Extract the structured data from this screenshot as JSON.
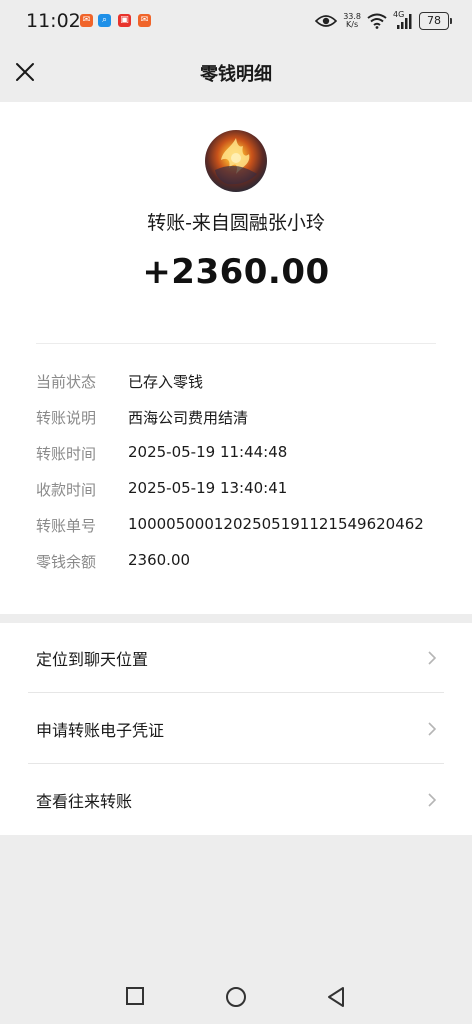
{
  "status_bar": {
    "time": "11:02",
    "net_speed_value": "33.8",
    "net_speed_unit": "K/s",
    "network_type": "4G",
    "battery_level": "78",
    "notification_icons": [
      "app-notification-icon",
      "app-notification-icon",
      "app-notification-icon",
      "app-notification-icon"
    ]
  },
  "header": {
    "title": "零钱明细",
    "close_icon": "close-icon"
  },
  "transfer": {
    "sender_line": "转账-来自圆融张小玲",
    "amount": "+2360.00"
  },
  "details": [
    {
      "label": "当前状态",
      "value": "已存入零钱"
    },
    {
      "label": "转账说明",
      "value": "西海公司费用结清"
    },
    {
      "label": "转账时间",
      "value": "2025-05-19 11:44:48"
    },
    {
      "label": "收款时间",
      "value": "2025-05-19 13:40:41"
    },
    {
      "label": "转账单号",
      "value": "1000050001202505191121549620462"
    },
    {
      "label": "零钱余额",
      "value": "2360.00"
    }
  ],
  "actions": [
    {
      "label": "定位到聊天位置"
    },
    {
      "label": "申请转账电子凭证"
    },
    {
      "label": "查看往来转账"
    }
  ],
  "nav_bar": {
    "icons": [
      "recents-square-icon",
      "home-circle-icon",
      "back-triangle-icon"
    ]
  },
  "colors": {
    "background": "#ededed",
    "card": "#ffffff",
    "label_gray": "#8a8a8a",
    "text": "#1a1a1a"
  }
}
